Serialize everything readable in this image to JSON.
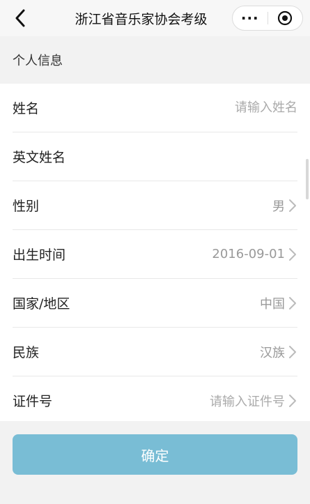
{
  "nav": {
    "title": "浙江省音乐家协会考级",
    "more_label": "···"
  },
  "section": {
    "title": "个人信息"
  },
  "form": {
    "name": {
      "label": "姓名",
      "placeholder": "请输入姓名"
    },
    "english_name": {
      "label": "英文姓名",
      "value": ""
    },
    "gender": {
      "label": "性别",
      "value": "男"
    },
    "birth": {
      "label": "出生时间",
      "value": "2016-09-01"
    },
    "country": {
      "label": "国家/地区",
      "value": "中国"
    },
    "ethnicity": {
      "label": "民族",
      "value": "汉族"
    },
    "id_number": {
      "label": "证件号",
      "placeholder": "请输入证件号"
    }
  },
  "confirm_button": {
    "label": "确定",
    "color": "#79bdd5"
  }
}
